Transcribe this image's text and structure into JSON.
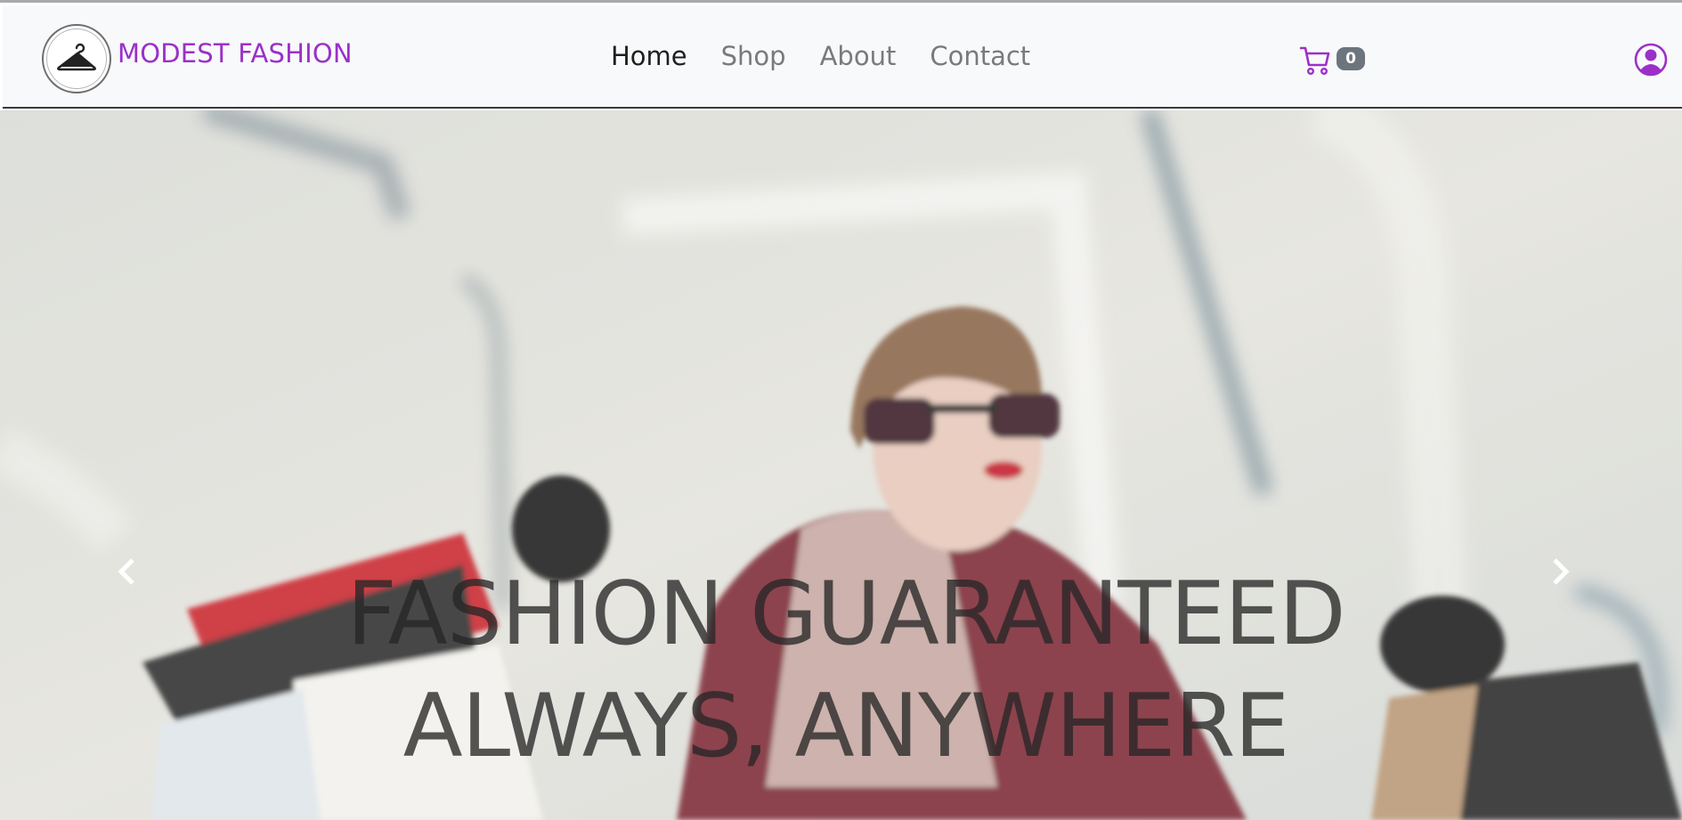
{
  "brand": {
    "name": "MODEST FASHION",
    "logo_icon": "hanger-icon",
    "color": "#9b30c8"
  },
  "nav": {
    "links": [
      {
        "label": "Home",
        "active": true
      },
      {
        "label": "Shop",
        "active": false
      },
      {
        "label": "About",
        "active": false
      },
      {
        "label": "Contact",
        "active": false
      }
    ]
  },
  "cart": {
    "icon": "cart-icon",
    "count": "0"
  },
  "user": {
    "icon": "user-circle-icon"
  },
  "hero": {
    "caption": "FASHION GUARANTEED ALWAYS, ANYWHERE",
    "prev_icon": "chevron-left-icon",
    "next_icon": "chevron-right-icon"
  },
  "colors": {
    "accent": "#9b30c8",
    "badge": "#6c757d",
    "navbar_bg": "#f8f9fb"
  }
}
